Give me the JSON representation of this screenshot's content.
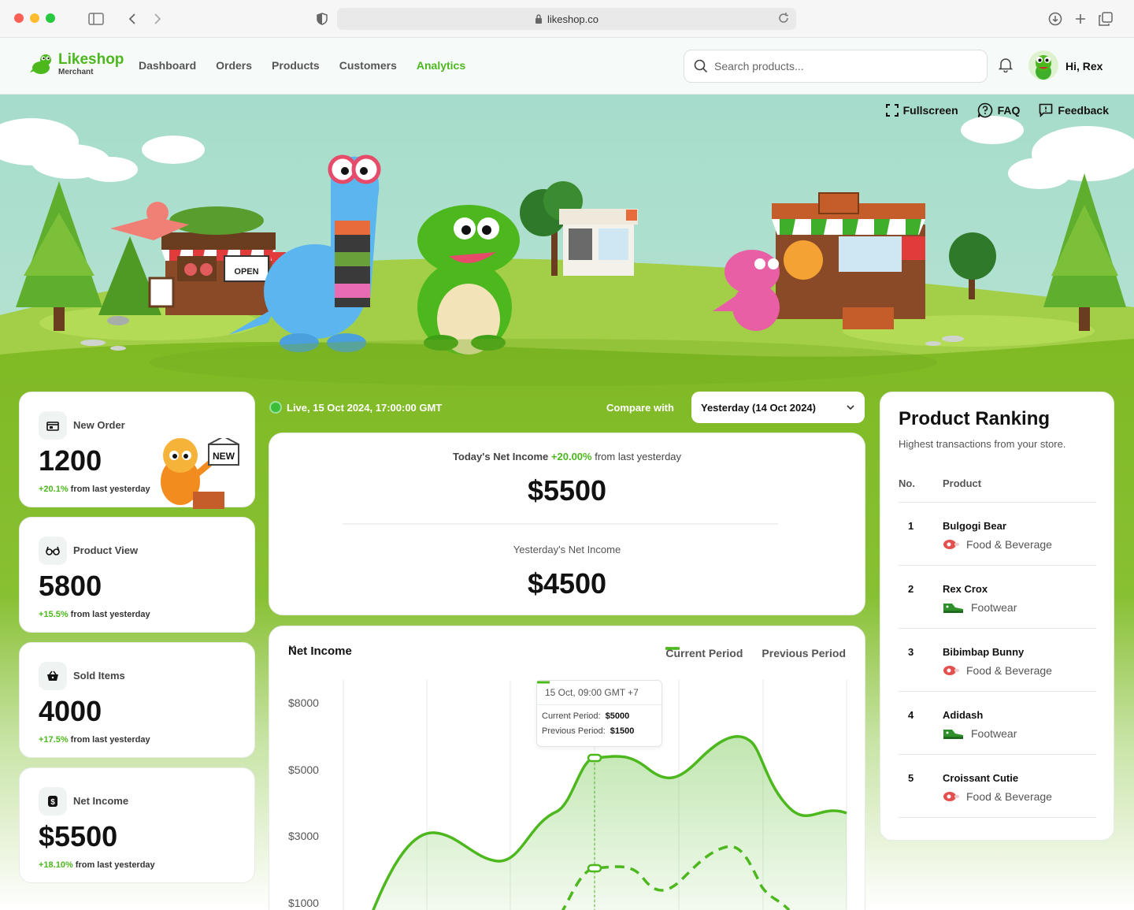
{
  "browser": {
    "url": "likeshop.co"
  },
  "header": {
    "brand": "Likeshop",
    "brand_sub": "Merchant",
    "nav": [
      "Dashboard",
      "Orders",
      "Products",
      "Customers",
      "Analytics"
    ],
    "active_nav": "Analytics",
    "search_placeholder": "Search products...",
    "greeting": "Hi, Rex"
  },
  "hero": {
    "links": {
      "fullscreen": "Fullscreen",
      "faq": "FAQ",
      "feedback": "Feedback"
    },
    "sign_open": "OPEN",
    "badge_new": "NEW"
  },
  "stats": [
    {
      "label": "New Order",
      "value": "1200",
      "pct": "+20.1%",
      "suffix": " from last yesterday"
    },
    {
      "label": "Product View",
      "value": "5800",
      "pct": "+15.5%",
      "suffix": " from last yesterday"
    },
    {
      "label": "Sold Items",
      "value": "4000",
      "pct": "+17.5%",
      "suffix": " from last yesterday"
    },
    {
      "label": "Net Income",
      "value": "$5500",
      "pct": "+18.10%",
      "suffix": " from last yesterday"
    }
  ],
  "live": {
    "text": "Live, 15 Oct 2024, 17:00:00 GMT",
    "compare_label": "Compare with",
    "compare_value": "Yesterday (14 Oct 2024)"
  },
  "income": {
    "today_label": "Today's Net Income",
    "today_pct": "+20.00%",
    "today_suffix": "from last yesterday",
    "today_value": "$5500",
    "yesterday_label": "Yesterday's Net Income",
    "yesterday_value": "$4500"
  },
  "chart": {
    "title": "Net Income",
    "legend_current": "Current Period",
    "legend_previous": "Previous Period",
    "y_ticks": [
      "$8000",
      "$5000",
      "$3000",
      "$1000"
    ],
    "tooltip": {
      "title": "15 Oct, 09:00 GMT +7",
      "current_label": "Current Period:",
      "current_value": "$5000",
      "previous_label": "Previous Period:",
      "previous_value": "$1500"
    },
    "colors": {
      "current": "#4cb81d",
      "previous": "#4cb81d"
    }
  },
  "ranking": {
    "title": "Product Ranking",
    "subtitle": "Highest transactions from your store.",
    "col_no": "No.",
    "col_product": "Product",
    "items": [
      {
        "no": "1",
        "name": "Bulgogi Bear",
        "category": "Food & Beverage"
      },
      {
        "no": "2",
        "name": "Rex Crox",
        "category": "Footwear"
      },
      {
        "no": "3",
        "name": "Bibimbap Bunny",
        "category": "Food & Beverage"
      },
      {
        "no": "4",
        "name": "Adidash",
        "category": "Footwear"
      },
      {
        "no": "5",
        "name": "Croissant Cutie",
        "category": "Food & Beverage"
      }
    ]
  }
}
